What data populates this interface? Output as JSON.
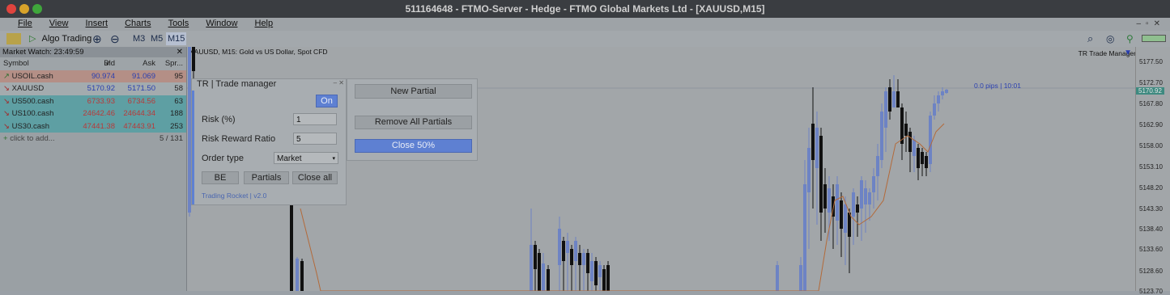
{
  "window": {
    "title": "511164648 - FTMO-Server - Hedge - FTMO Global Markets Ltd - [XAUUSD,M15]"
  },
  "menu": [
    "File",
    "View",
    "Insert",
    "Charts",
    "Tools",
    "Window",
    "Help"
  ],
  "toolbar": {
    "algo_trading": "Algo Trading",
    "timeframes": [
      "M3",
      "M5",
      "M15"
    ]
  },
  "market_watch": {
    "title": "Market Watch: 23:49:59",
    "columns": {
      "symbol": "Symbol",
      "bid": "Bid",
      "ask": "Ask",
      "spread": "Spr..."
    },
    "rows": [
      {
        "symbol": "USOIL.cash",
        "bid": "90.974",
        "ask": "91.069",
        "spread": "95"
      },
      {
        "symbol": "XAUUSD",
        "bid": "5170.92",
        "ask": "5171.50",
        "spread": "58"
      },
      {
        "symbol": "US500.cash",
        "bid": "6733.93",
        "ask": "6734.56",
        "spread": "63"
      },
      {
        "symbol": "US100.cash",
        "bid": "24642.46",
        "ask": "24644.34",
        "spread": "188"
      },
      {
        "symbol": "US30.cash",
        "bid": "47441.38",
        "ask": "47443.91",
        "spread": "253"
      }
    ],
    "add_label": "click to add...",
    "count": "5 / 131"
  },
  "chart": {
    "label": "XAUUSD, M15:  Gold vs US Dollar, Spot CFD",
    "tr_label": "TR Trade Manager",
    "pips_label": "0.0 pips | 10:01",
    "price_levels": [
      "5177.50",
      "5172.70",
      "5170.92",
      "5167.80",
      "5162.90",
      "5158.00",
      "5153.10",
      "5148.20",
      "5143.30",
      "5138.40",
      "5133.60",
      "5128.60",
      "5123.70"
    ]
  },
  "trade_manager": {
    "title": "TR  |  Trade manager",
    "on_button": "On",
    "risk_label": "Risk (%)",
    "risk_value": "1",
    "rr_label": "Risk Reward Ratio",
    "rr_value": "5",
    "order_type_label": "Order type",
    "order_type_value": "Market",
    "be_button": "BE",
    "partials_button": "Partials",
    "close_all_button": "Close all",
    "footer": "Trading Rocket  |  v2.0"
  },
  "partials_panel": {
    "new_partial": "New Partial",
    "remove_all": "Remove All Partials",
    "close_50": "Close 50%"
  },
  "colors": {
    "bull_candle": "#6d83c4",
    "bear_candle": "#111111",
    "accent_blue": "#5e80d2"
  }
}
